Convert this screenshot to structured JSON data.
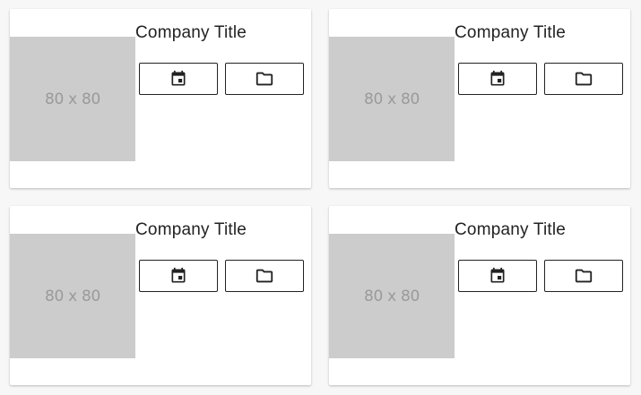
{
  "cards": [
    {
      "title": "Company Title",
      "thumbnail_text": "80 x 80",
      "buttons": [
        {
          "icon": "calendar-icon"
        },
        {
          "icon": "folder-icon"
        },
        {
          "icon": "unknown-icon"
        }
      ]
    },
    {
      "title": "Company Title",
      "thumbnail_text": "80 x 80",
      "buttons": [
        {
          "icon": "calendar-icon"
        },
        {
          "icon": "folder-icon"
        },
        {
          "icon": "unknown-icon"
        }
      ]
    },
    {
      "title": "Company Title",
      "thumbnail_text": "80 x 80",
      "buttons": [
        {
          "icon": "calendar-icon"
        },
        {
          "icon": "folder-icon"
        },
        {
          "icon": "unknown-icon"
        }
      ]
    },
    {
      "title": "Company Title",
      "thumbnail_text": "80 x 80",
      "buttons": [
        {
          "icon": "calendar-icon"
        },
        {
          "icon": "folder-icon"
        },
        {
          "icon": "unknown-icon"
        }
      ]
    }
  ],
  "colors": {
    "page_background": "#f7f7f7",
    "card_background": "#ffffff",
    "thumbnail_background": "#cccccc",
    "thumbnail_text": "#9a9a9a",
    "title_text": "#222222",
    "button_border": "#222222"
  }
}
